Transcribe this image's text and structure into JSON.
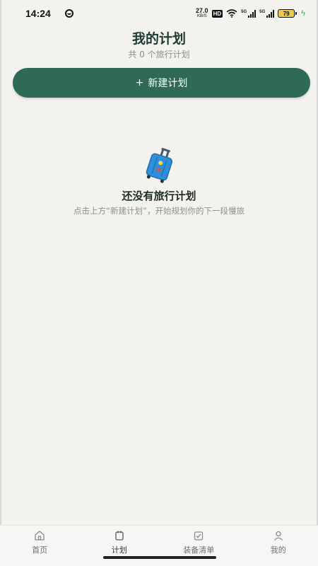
{
  "status": {
    "time": "14:24",
    "net_speed_value": "27.0",
    "net_speed_unit": "KB/S",
    "hd_label": "HD",
    "sig1_label": "5G",
    "sig2_label": "5G",
    "battery": "79"
  },
  "header": {
    "title": "我的计划",
    "subtitle": "共 0 个旅行计划"
  },
  "new_plan_button": {
    "icon": "+",
    "label": "新建计划"
  },
  "empty_state": {
    "icon": "suitcase-icon",
    "title": "还没有旅行计划",
    "description": "点击上方“新建计划”，开始规划你的下一段慢旅"
  },
  "tabs": [
    {
      "label": "首页",
      "icon": "home-icon",
      "active": false
    },
    {
      "label": "计划",
      "icon": "plan-icon",
      "active": true
    },
    {
      "label": "装备清单",
      "icon": "checklist-icon",
      "active": false
    },
    {
      "label": "我的",
      "icon": "profile-icon",
      "active": false
    }
  ],
  "colors": {
    "accent": "#2f6a58",
    "background": "#f3f2ee",
    "suitcase": "#2f8fd8"
  }
}
